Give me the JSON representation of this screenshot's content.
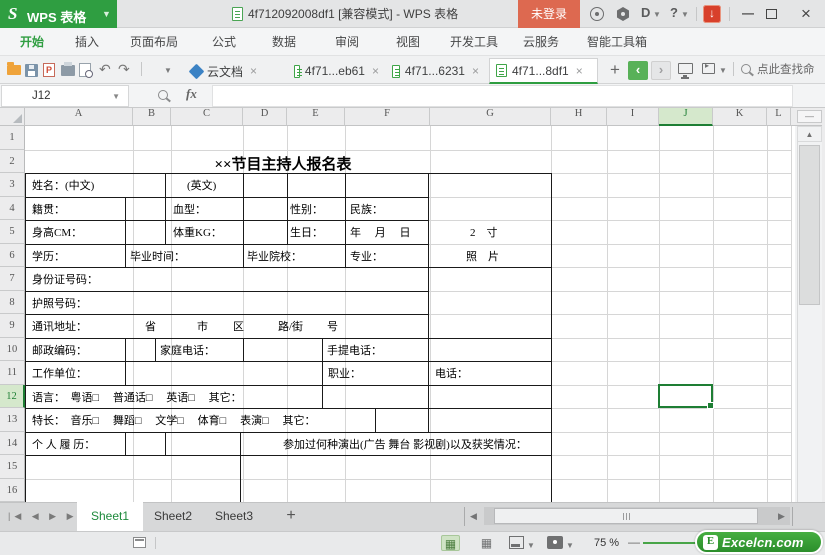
{
  "window": {
    "app_button": "WPS 表格",
    "title": "4f712092008df1 [兼容模式] - WPS 表格",
    "login_button": "未登录"
  },
  "ribbon": {
    "active_tab": "开始",
    "tabs": [
      "开始",
      "插入",
      "页面布局",
      "公式",
      "数据",
      "审阅",
      "视图",
      "开发工具",
      "云服务",
      "智能工具箱"
    ]
  },
  "doc_tabs": {
    "items": [
      {
        "label": "云文档",
        "type": "cloud",
        "active": false
      },
      {
        "label": "4f71...eb61",
        "type": "sheet",
        "active": false
      },
      {
        "label": "4f71...6231",
        "type": "sheet",
        "active": false
      },
      {
        "label": "4f71...8df1",
        "type": "sheet",
        "active": true
      }
    ],
    "search_placeholder": "点此查找命令"
  },
  "formula_bar": {
    "name_box": "J12",
    "fx_label": "fx",
    "formula_value": ""
  },
  "grid": {
    "columns": [
      "A",
      "B",
      "C",
      "D",
      "E",
      "F",
      "G",
      "H",
      "I",
      "J",
      "K",
      "L"
    ],
    "rows": [
      "1",
      "2",
      "3",
      "4",
      "5",
      "6",
      "7",
      "8",
      "9",
      "10",
      "11",
      "12",
      "13",
      "14",
      "15",
      "16"
    ],
    "selected_cell": "J12",
    "selected_column": "J",
    "selected_row": "12"
  },
  "form": {
    "title": "××节目主持人报名表",
    "cells": [
      {
        "id": "name_cn",
        "text": "姓名：(中文)"
      },
      {
        "id": "name_en",
        "text": "(英文)"
      },
      {
        "id": "native_place",
        "text": "籍贯："
      },
      {
        "id": "blood_type",
        "text": "血型："
      },
      {
        "id": "gender",
        "text": "性别："
      },
      {
        "id": "ethnicity",
        "text": "民族："
      },
      {
        "id": "height",
        "text": "身高CM："
      },
      {
        "id": "weight",
        "text": "体重KG："
      },
      {
        "id": "birthday",
        "text": "生日："
      },
      {
        "id": "ymd",
        "text": "年　 月　 日"
      },
      {
        "id": "education",
        "text": "学历："
      },
      {
        "id": "grad_time",
        "text": "毕业时间："
      },
      {
        "id": "grad_school",
        "text": "毕业院校："
      },
      {
        "id": "major",
        "text": "专业："
      },
      {
        "id": "id_number",
        "text": "身份证号码："
      },
      {
        "id": "passport",
        "text": "护照号码："
      },
      {
        "id": "address",
        "text": "通讯地址："
      },
      {
        "id": "province",
        "text": "省"
      },
      {
        "id": "city",
        "text": "市"
      },
      {
        "id": "district",
        "text": "区"
      },
      {
        "id": "road",
        "text": "路/街"
      },
      {
        "id": "house_no",
        "text": "号"
      },
      {
        "id": "postal",
        "text": "邮政编码："
      },
      {
        "id": "home_phone",
        "text": "家庭电话："
      },
      {
        "id": "mobile",
        "text": "手提电话："
      },
      {
        "id": "work_unit",
        "text": "工作单位："
      },
      {
        "id": "occupation",
        "text": "职业："
      },
      {
        "id": "phone",
        "text": "电话："
      },
      {
        "id": "languages",
        "text": "语言：  粤语□　 普通话□　 英语□　 其它："
      },
      {
        "id": "specialties",
        "text": "特长：  音乐□　 舞蹈□　 文学□　 体育□　 表演□　 其它："
      },
      {
        "id": "resume",
        "text": "个 人 履 历："
      },
      {
        "id": "performance",
        "text": "参加过何种演出(广告 舞台 影视剧)以及获奖情况："
      },
      {
        "id": "photo_size",
        "text": "2　寸"
      },
      {
        "id": "photo",
        "text": "照　片"
      }
    ]
  },
  "sheet_bar": {
    "sheets": [
      "Sheet1",
      "Sheet2",
      "Sheet3"
    ],
    "active_sheet": "Sheet1"
  },
  "status_bar": {
    "zoom_level": "75 %",
    "watermark_letter": "E",
    "watermark_text": "Excelcn.com"
  }
}
